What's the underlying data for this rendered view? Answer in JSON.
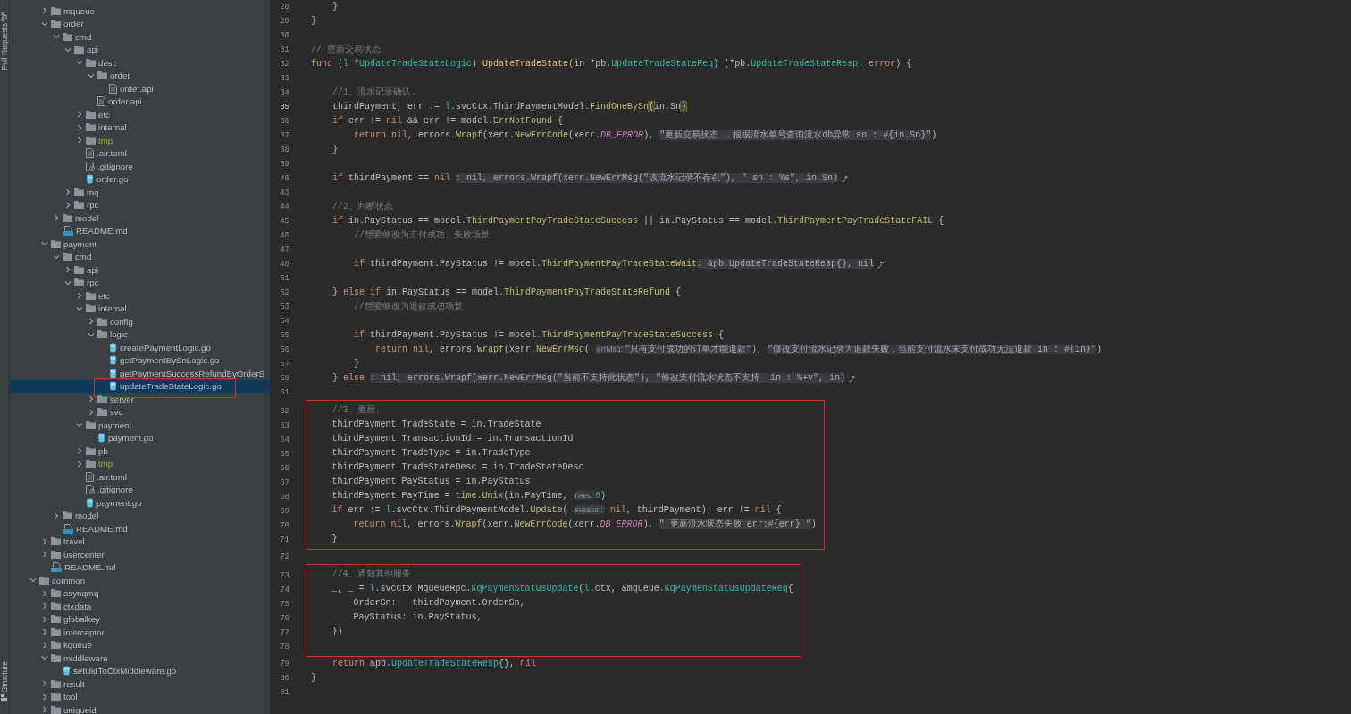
{
  "side_strip": {
    "top_tab": "Pull Requests",
    "bottom_tab": "Structure"
  },
  "tree": {
    "continued": [
      {
        "name": "mqueue",
        "kind": "folder",
        "expanded": false
      },
      {
        "name": "order",
        "kind": "folder",
        "expanded": true,
        "children": [
          {
            "name": "cmd",
            "kind": "folder",
            "expanded": true,
            "children": [
              {
                "name": "api",
                "kind": "folder",
                "expanded": true,
                "children": [
                  {
                    "name": "desc",
                    "kind": "folder",
                    "expanded": true,
                    "children": [
                      {
                        "name": "order",
                        "kind": "folder",
                        "expanded": true,
                        "children": [
                          {
                            "name": "order.api",
                            "kind": "doc"
                          }
                        ]
                      },
                      {
                        "name": "order.api",
                        "kind": "doc"
                      }
                    ]
                  },
                  {
                    "name": "etc",
                    "kind": "folder",
                    "expanded": false
                  },
                  {
                    "name": "internal",
                    "kind": "folder",
                    "expanded": false
                  },
                  {
                    "name": "tmp",
                    "kind": "folder",
                    "expanded": false,
                    "excluded": true
                  },
                  {
                    "name": ".air.toml",
                    "kind": "doc"
                  },
                  {
                    "name": ".gitignore",
                    "kind": "ignore"
                  },
                  {
                    "name": "order.go",
                    "kind": "go"
                  }
                ]
              },
              {
                "name": "mq",
                "kind": "folder",
                "expanded": false
              },
              {
                "name": "rpc",
                "kind": "folder",
                "expanded": false
              }
            ]
          },
          {
            "name": "model",
            "kind": "folder",
            "expanded": false
          },
          {
            "name": "README.md",
            "kind": "md"
          }
        ]
      },
      {
        "name": "payment",
        "kind": "folder",
        "expanded": true,
        "children": [
          {
            "name": "cmd",
            "kind": "folder",
            "expanded": true,
            "children": [
              {
                "name": "api",
                "kind": "folder",
                "expanded": false
              },
              {
                "name": "rpc",
                "kind": "folder",
                "expanded": true,
                "children": [
                  {
                    "name": "etc",
                    "kind": "folder",
                    "expanded": false
                  },
                  {
                    "name": "internal",
                    "kind": "folder",
                    "expanded": true,
                    "children": [
                      {
                        "name": "config",
                        "kind": "folder",
                        "expanded": false
                      },
                      {
                        "name": "logic",
                        "kind": "folder",
                        "expanded": true,
                        "children": [
                          {
                            "name": "createPaymentLogic.go",
                            "kind": "go"
                          },
                          {
                            "name": "getPaymentBySnLogic.go",
                            "kind": "go"
                          },
                          {
                            "name": "getPaymentSuccessRefundByOrderS",
                            "kind": "go"
                          },
                          {
                            "name": "updateTradeStateLogic.go",
                            "kind": "go",
                            "selected": true,
                            "boxed": true
                          }
                        ]
                      },
                      {
                        "name": "server",
                        "kind": "folder",
                        "expanded": false
                      },
                      {
                        "name": "svc",
                        "kind": "folder",
                        "expanded": false
                      }
                    ]
                  },
                  {
                    "name": "payment",
                    "kind": "folder",
                    "expanded": true,
                    "children": [
                      {
                        "name": "payment.go",
                        "kind": "go"
                      }
                    ]
                  },
                  {
                    "name": "pb",
                    "kind": "folder",
                    "expanded": false
                  },
                  {
                    "name": "tmp",
                    "kind": "folder",
                    "expanded": false,
                    "excluded": true
                  },
                  {
                    "name": ".air.toml",
                    "kind": "doc"
                  },
                  {
                    "name": ".gitignore",
                    "kind": "ignore"
                  },
                  {
                    "name": "payment.go",
                    "kind": "go"
                  }
                ]
              }
            ]
          },
          {
            "name": "model",
            "kind": "folder",
            "expanded": false
          },
          {
            "name": "README.md",
            "kind": "md"
          }
        ]
      },
      {
        "name": "travel",
        "kind": "folder",
        "expanded": false
      },
      {
        "name": "usercenter",
        "kind": "folder",
        "expanded": false
      },
      {
        "name": "README.md",
        "kind": "md"
      }
    ],
    "roots": [
      {
        "name": "common",
        "kind": "folder",
        "expanded": true,
        "children": [
          {
            "name": "asynqmq",
            "kind": "folder",
            "expanded": false
          },
          {
            "name": "ctxdata",
            "kind": "folder",
            "expanded": false
          },
          {
            "name": "globalkey",
            "kind": "folder",
            "expanded": false
          },
          {
            "name": "interceptor",
            "kind": "folder",
            "expanded": false
          },
          {
            "name": "kqueue",
            "kind": "folder",
            "expanded": false
          },
          {
            "name": "middleware",
            "kind": "folder",
            "expanded": true,
            "children": [
              {
                "name": "setUidToCtxMiddleware.go",
                "kind": "go"
              }
            ]
          },
          {
            "name": "result",
            "kind": "folder",
            "expanded": false
          },
          {
            "name": "tool",
            "kind": "folder",
            "expanded": false
          },
          {
            "name": "uniqueid",
            "kind": "folder",
            "expanded": false
          }
        ]
      }
    ]
  },
  "editor": {
    "sections": [
      {
        "boxed": false,
        "lines": [
          {
            "n": "28",
            "tokens": [
              {
                "kind": "plain",
                "text": "    }"
              }
            ]
          },
          {
            "n": "29",
            "tokens": [
              {
                "kind": "plain",
                "text": "}"
              }
            ]
          },
          {
            "n": "30"
          },
          {
            "n": "31",
            "tokens": [
              {
                "kind": "cm",
                "text": "// 更新交易状态"
              }
            ]
          },
          {
            "n": "32",
            "tokens": [
              {
                "kind": "kw",
                "text": "func"
              },
              {
                "kind": "plain",
                "text": " ("
              },
              {
                "kind": "recv",
                "text": "l"
              },
              {
                "kind": "plain",
                "text": " *"
              },
              {
                "kind": "type",
                "text": "UpdateTradeStateLogic"
              },
              {
                "kind": "plain",
                "text": ") "
              },
              {
                "kind": "fn",
                "text": "UpdateTradeState"
              },
              {
                "kind": "plain",
                "text": "(in *pb."
              },
              {
                "kind": "type",
                "text": "UpdateTradeStateReq"
              },
              {
                "kind": "plain",
                "text": ") (*pb."
              },
              {
                "kind": "type",
                "text": "UpdateTradeStateResp"
              },
              {
                "kind": "plain",
                "text": ", "
              },
              {
                "kind": "kw",
                "text": "error"
              },
              {
                "kind": "plain",
                "text": ") {"
              }
            ]
          },
          {
            "n": "33"
          },
          {
            "n": "34",
            "tokens": [
              {
                "kind": "cm",
                "text": "    //1、流水记录确认."
              }
            ]
          },
          {
            "n": "35",
            "current": true,
            "tokens": [
              {
                "kind": "plain",
                "text": "    thirdPayment, err := "
              },
              {
                "kind": "recv",
                "text": "l"
              },
              {
                "kind": "plain",
                "text": ".svcCtx.ThirdPaymentModel."
              },
              {
                "kind": "call",
                "text": "FindOneBySn"
              },
              {
                "kind": "match",
                "text": "("
              },
              {
                "kind": "plain",
                "text": "in.Sn"
              },
              {
                "kind": "match",
                "text": ")"
              }
            ]
          },
          {
            "n": "36",
            "tokens": [
              {
                "kind": "kw",
                "text": "    if"
              },
              {
                "kind": "plain",
                "text": " err != "
              },
              {
                "kind": "kw",
                "text": "nil"
              },
              {
                "kind": "plain",
                "text": " && err != model."
              },
              {
                "kind": "call",
                "text": "ErrNotFound"
              },
              {
                "kind": "plain",
                "text": " {"
              }
            ]
          },
          {
            "n": "37",
            "tokens": [
              {
                "kind": "kw",
                "text": "        return nil"
              },
              {
                "kind": "plain",
                "text": ", errors."
              },
              {
                "kind": "call",
                "text": "Wrapf"
              },
              {
                "kind": "plain",
                "text": "(xerr."
              },
              {
                "kind": "call",
                "text": "NewErrCode"
              },
              {
                "kind": "plain",
                "text": "(xerr."
              },
              {
                "kind": "const",
                "text": "DB_ERROR"
              },
              {
                "kind": "plain",
                "text": "), "
              },
              {
                "kind": "fold",
                "text": "\"更新交易状态 ，根据流水单号查询流水db异常 sn : #{in.Sn}\""
              },
              {
                "kind": "plain",
                "text": ")"
              }
            ]
          },
          {
            "n": "38",
            "tokens": [
              {
                "kind": "plain",
                "text": "    }"
              }
            ]
          },
          {
            "n": "39"
          },
          {
            "n": "40",
            "folded": true,
            "tokens": [
              {
                "kind": "kw",
                "text": "    if"
              },
              {
                "kind": "plain",
                "text": " thirdPayment == "
              },
              {
                "kind": "kw",
                "text": "nil "
              },
              {
                "kind": "fold",
                "text": ": nil, errors.Wrapf(xerr.NewErrMsg(\"该流水记录不存在\"), \" sn : %s\", in.Sn)"
              }
            ]
          },
          {
            "n": "43"
          },
          {
            "n": "44",
            "tokens": [
              {
                "kind": "cm",
                "text": "    //2、判断状态"
              }
            ]
          },
          {
            "n": "45",
            "tokens": [
              {
                "kind": "kw",
                "text": "    if"
              },
              {
                "kind": "plain",
                "text": " in.PayStatus == model."
              },
              {
                "kind": "call",
                "text": "ThirdPaymentPayTradeStateSuccess"
              },
              {
                "kind": "plain",
                "text": " || in.PayStatus == model."
              },
              {
                "kind": "call",
                "text": "ThirdPaymentPayTradeStateFAIL"
              },
              {
                "kind": "plain",
                "text": " {"
              }
            ]
          },
          {
            "n": "46",
            "tokens": [
              {
                "kind": "cm",
                "text": "        //想要修改为支付成功、失败场景"
              }
            ]
          },
          {
            "n": "47"
          },
          {
            "n": "48",
            "folded": true,
            "tokens": [
              {
                "kind": "kw",
                "text": "        if"
              },
              {
                "kind": "plain",
                "text": " thirdPayment.PayStatus != model."
              },
              {
                "kind": "call",
                "text": "ThirdPaymentPayTradeStateWait"
              },
              {
                "kind": "fold",
                "text": ": &pb.UpdateTradeStateResp{}, nil"
              }
            ]
          },
          {
            "n": "51"
          },
          {
            "n": "52",
            "tokens": [
              {
                "kind": "plain",
                "text": "    } "
              },
              {
                "kind": "kw",
                "text": "else if"
              },
              {
                "kind": "plain",
                "text": " in.PayStatus == model."
              },
              {
                "kind": "call",
                "text": "ThirdPaymentPayTradeStateRefund"
              },
              {
                "kind": "plain",
                "text": " {"
              }
            ]
          },
          {
            "n": "53",
            "tokens": [
              {
                "kind": "cm",
                "text": "        //想要修改为退款成功场景"
              }
            ]
          },
          {
            "n": "54"
          },
          {
            "n": "55",
            "tokens": [
              {
                "kind": "kw",
                "text": "        if"
              },
              {
                "kind": "plain",
                "text": " thirdPayment.PayStatus != model."
              },
              {
                "kind": "call",
                "text": "ThirdPaymentPayTradeStateSuccess"
              },
              {
                "kind": "plain",
                "text": " {"
              }
            ]
          },
          {
            "n": "56",
            "tokens": [
              {
                "kind": "kw",
                "text": "            return nil"
              },
              {
                "kind": "plain",
                "text": ", errors."
              },
              {
                "kind": "call",
                "text": "Wrapf"
              },
              {
                "kind": "plain",
                "text": "(xerr."
              },
              {
                "kind": "call",
                "text": "NewErrMsg"
              },
              {
                "kind": "plain",
                "text": "( "
              },
              {
                "kind": "hint",
                "text": "errMsg:"
              },
              {
                "kind": "fold",
                "text": "\"只有支付成功的订单才能退款\""
              },
              {
                "kind": "plain",
                "text": "), "
              },
              {
                "kind": "fold",
                "text": "\"修改支付流水记录为退款失败，当前支付流水未支付成功无法退款 in : #{in}\""
              },
              {
                "kind": "plain",
                "text": ")"
              }
            ]
          },
          {
            "n": "57",
            "tokens": [
              {
                "kind": "plain",
                "text": "        }"
              }
            ]
          },
          {
            "n": "58",
            "folded": true,
            "tokens": [
              {
                "kind": "plain",
                "text": "    } "
              },
              {
                "kind": "kw",
                "text": "else "
              },
              {
                "kind": "fold",
                "text": ": nil, errors.Wrapf(xerr.NewErrMsg(\"当前不支持此状态\"), \"修改支付流水状态不支持  in : %+v\", in)"
              }
            ]
          },
          {
            "n": "61"
          }
        ]
      },
      {
        "boxed": true,
        "lines": [
          {
            "n": "62",
            "tokens": [
              {
                "kind": "cm",
                "text": "    //3、更新."
              }
            ]
          },
          {
            "n": "63",
            "tokens": [
              {
                "kind": "plain",
                "text": "    thirdPayment.TradeState = in.TradeState"
              }
            ]
          },
          {
            "n": "64",
            "tokens": [
              {
                "kind": "plain",
                "text": "    thirdPayment.TransactionId = in.TransactionId"
              }
            ]
          },
          {
            "n": "65",
            "tokens": [
              {
                "kind": "plain",
                "text": "    thirdPayment.TradeType = in.TradeType"
              }
            ]
          },
          {
            "n": "66",
            "tokens": [
              {
                "kind": "plain",
                "text": "    thirdPayment.TradeStateDesc = in.TradeStateDesc"
              }
            ]
          },
          {
            "n": "67",
            "tokens": [
              {
                "kind": "plain",
                "text": "    thirdPayment.PayStatus = in.PayStatus"
              }
            ]
          },
          {
            "n": "68",
            "tokens": [
              {
                "kind": "plain",
                "text": "    thirdPayment.PayTime = "
              },
              {
                "kind": "call",
                "text": "time"
              },
              {
                "kind": "plain",
                "text": "."
              },
              {
                "kind": "call",
                "text": "Unix"
              },
              {
                "kind": "plain",
                "text": "(in.PayTime, "
              },
              {
                "kind": "hint",
                "text": "nsec:"
              },
              {
                "kind": "num",
                "text": "0"
              },
              {
                "kind": "plain",
                "text": ")"
              }
            ]
          },
          {
            "n": "69",
            "tokens": [
              {
                "kind": "kw",
                "text": "    if"
              },
              {
                "kind": "plain",
                "text": " err := "
              },
              {
                "kind": "recv",
                "text": "l"
              },
              {
                "kind": "plain",
                "text": ".svcCtx.ThirdPaymentModel."
              },
              {
                "kind": "call",
                "text": "Update"
              },
              {
                "kind": "plain",
                "text": "( "
              },
              {
                "kind": "hint",
                "text": "session:"
              },
              {
                "kind": "kw",
                "text": " nil"
              },
              {
                "kind": "plain",
                "text": ", thirdPayment); err != "
              },
              {
                "kind": "kw",
                "text": "nil"
              },
              {
                "kind": "plain",
                "text": " {"
              }
            ]
          },
          {
            "n": "70",
            "tokens": [
              {
                "kind": "kw",
                "text": "        return nil"
              },
              {
                "kind": "plain",
                "text": ", errors."
              },
              {
                "kind": "call",
                "text": "Wrapf"
              },
              {
                "kind": "plain",
                "text": "(xerr."
              },
              {
                "kind": "call",
                "text": "NewErrCode"
              },
              {
                "kind": "plain",
                "text": "(xerr."
              },
              {
                "kind": "const",
                "text": "DB_ERROR"
              },
              {
                "kind": "plain",
                "text": "), "
              },
              {
                "kind": "fold",
                "text": "\" 更新流水状态失败 err:#{err} \""
              },
              {
                "kind": "plain",
                "text": ")"
              }
            ]
          },
          {
            "n": "71",
            "tokens": [
              {
                "kind": "plain",
                "text": "    }"
              }
            ]
          }
        ]
      },
      {
        "boxed": false,
        "lines": [
          {
            "n": "72"
          }
        ]
      },
      {
        "boxed": true,
        "lines": [
          {
            "n": "73",
            "tokens": [
              {
                "kind": "cm",
                "text": "    //4、通知其他服务"
              }
            ]
          },
          {
            "n": "74",
            "tokens": [
              {
                "kind": "plain",
                "text": "    _, _ = "
              },
              {
                "kind": "recv",
                "text": "l"
              },
              {
                "kind": "plain",
                "text": ".svcCtx.MqueueRpc."
              },
              {
                "kind": "type",
                "text": "KqPaymenStatusUpdate"
              },
              {
                "kind": "plain",
                "text": "("
              },
              {
                "kind": "recv",
                "text": "l"
              },
              {
                "kind": "plain",
                "text": ".ctx, &mqueue."
              },
              {
                "kind": "type",
                "text": "KqPaymenStatusUpdateReq"
              },
              {
                "kind": "plain",
                "text": "{"
              }
            ]
          },
          {
            "n": "75",
            "tokens": [
              {
                "kind": "plain",
                "text": "        OrderSn:   thirdPayment.OrderSn,"
              }
            ]
          },
          {
            "n": "76",
            "tokens": [
              {
                "kind": "plain",
                "text": "        PayStatus: in.PayStatus,"
              }
            ]
          },
          {
            "n": "77",
            "tokens": [
              {
                "kind": "plain",
                "text": "    })"
              }
            ]
          },
          {
            "n": "78"
          }
        ]
      },
      {
        "boxed": false,
        "lines": [
          {
            "n": "79",
            "tokens": [
              {
                "kind": "kw",
                "text": "    return"
              },
              {
                "kind": "plain",
                "text": " &pb."
              },
              {
                "kind": "type",
                "text": "UpdateTradeStateResp"
              },
              {
                "kind": "plain",
                "text": "{}, "
              },
              {
                "kind": "kw",
                "text": "nil"
              }
            ]
          },
          {
            "n": "80",
            "tokens": [
              {
                "kind": "plain",
                "text": "}"
              }
            ]
          },
          {
            "n": "81"
          }
        ]
      }
    ]
  }
}
